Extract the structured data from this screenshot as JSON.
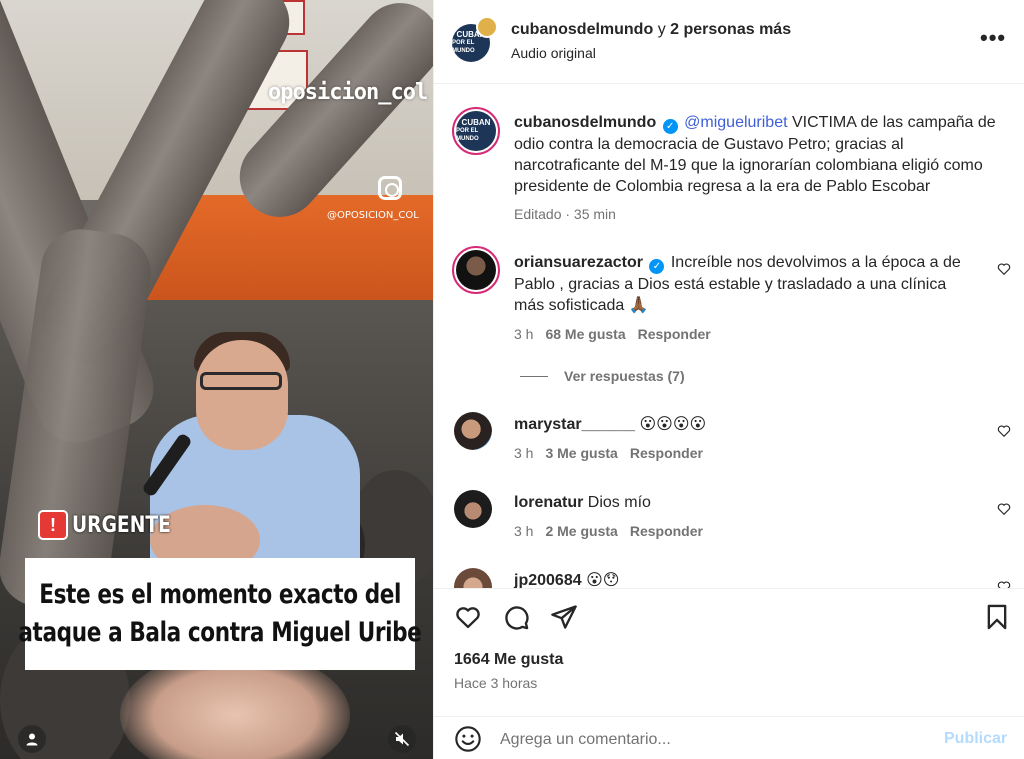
{
  "video": {
    "watermark": "oposicion_col",
    "watermark_handle": "@OPOSICION_COL",
    "badge_label": "URGENTE",
    "caption_line1": "Este es el momento exacto del",
    "caption_line2": "ataque a Bala contra Miguel Uribe",
    "user_icon": "user-icon",
    "mute_icon": "speaker-muted-icon"
  },
  "header": {
    "username": "cubanosdelmundo",
    "connector": "y",
    "others": "2 personas más",
    "audio": "Audio original",
    "more_icon": "•••"
  },
  "caption": {
    "username": "cubanosdelmundo",
    "mention": "@migueluribet",
    "text": "VICTIMA de las campaña de odio contra la democracia de Gustavo Petro; gracias al narcotraficante del M-19 que la ignorarían colombiana eligió como presidente de Colombia regresa a la era de Pablo Escobar",
    "meta": "Editado · 35 min"
  },
  "comments": [
    {
      "username": "oriansuarezactor",
      "verified": true,
      "text": "Increíble nos devolvimos a la época a de Pablo , gracias a Dios está estable y trasladado a una clínica más sofisticada 🙏🏾",
      "time": "3 h",
      "likes": "68 Me gusta",
      "reply": "Responder"
    },
    {
      "username": "marystar______",
      "text": "😮😮😮😮",
      "time": "3 h",
      "likes": "3 Me gusta",
      "reply": "Responder"
    },
    {
      "username": "lorenatur",
      "text": "Dios mío",
      "time": "3 h",
      "likes": "2 Me gusta",
      "reply": "Responder"
    },
    {
      "username": "jp200684",
      "text": "😮😯"
    }
  ],
  "view_replies": "Ver respuestas (7)",
  "post": {
    "likes": "1664 Me gusta",
    "time": "Hace 3 horas"
  },
  "composer": {
    "placeholder": "Agrega un comentario...",
    "publish": "Publicar"
  },
  "colors": {
    "accent_blue": "#0095f6",
    "publish_disabled": "#b3dbff",
    "mention": "#3f5fd6",
    "secondary_text": "#737373"
  }
}
